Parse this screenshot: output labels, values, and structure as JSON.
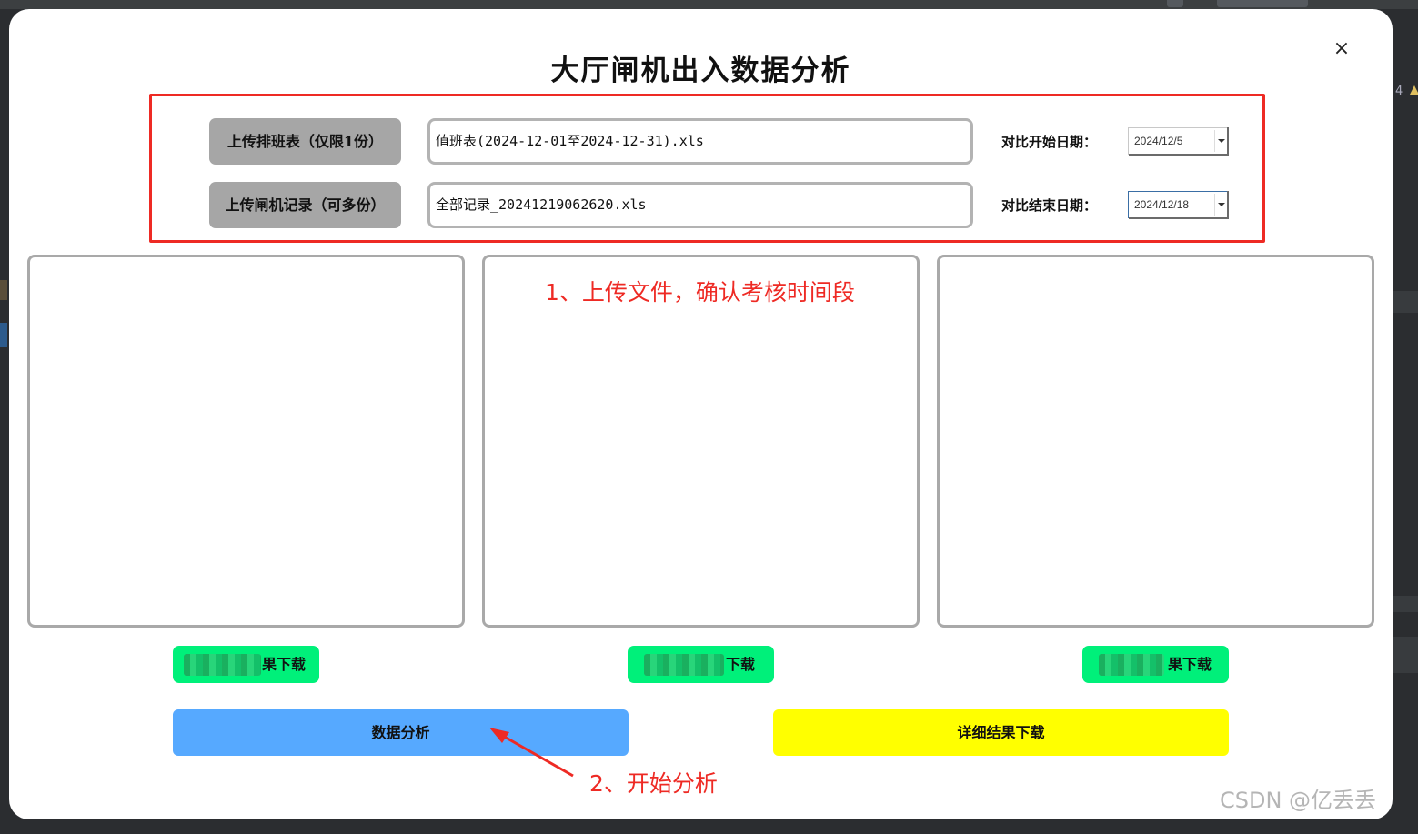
{
  "dialog": {
    "title": "大厅闸机出入数据分析",
    "close_label": "×"
  },
  "upload": {
    "schedule_button": "上传排班表（仅限1份）",
    "schedule_file": "值班表(2024-12-01至2024-12-31).xls",
    "records_button": "上传闸机记录（可多份）",
    "records_file": "全部记录_20241219062620.xls",
    "start_label": "对比开始日期：",
    "start_date": "2024/12/5",
    "end_label": "对比结束日期：",
    "end_date": "2024/12/18"
  },
  "annotations": {
    "step1": "1、上传文件，确认考核时间段",
    "step2": "2、开始分析"
  },
  "download_buttons": [
    {
      "label": "果下载"
    },
    {
      "label": "下载"
    },
    {
      "label": "果下载"
    }
  ],
  "actions": {
    "analyze": "数据分析",
    "detail_download": "详细结果下载"
  },
  "colors": {
    "highlight_box": "#ee2a24",
    "upload_button": "#a6a6a6",
    "download_button": "#00f07a",
    "analyze_button": "#56a9ff",
    "detail_button": "#ffff00"
  },
  "watermark": "CSDN @亿丢丢",
  "background_ide": {
    "right_number": "4"
  }
}
